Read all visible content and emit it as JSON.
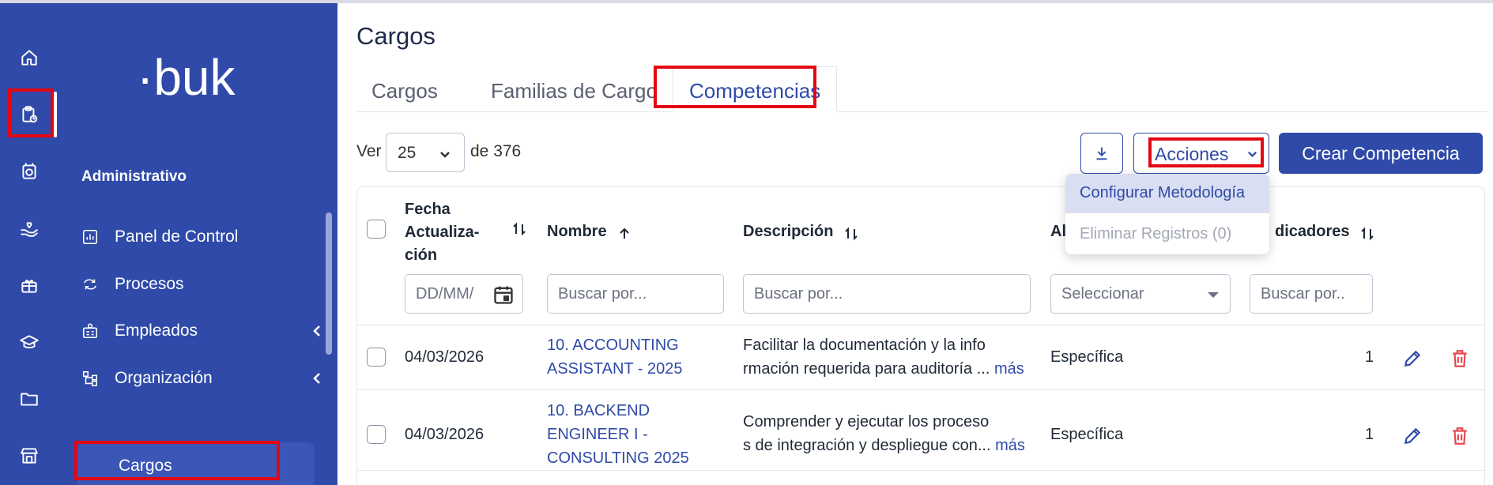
{
  "sidebar": {
    "logo_text": "·buk·",
    "section_title": "Administrativo",
    "nav_items": [
      {
        "label": "Panel de Control",
        "icon": "chart-icon"
      },
      {
        "label": "Procesos",
        "icon": "refresh-icon"
      },
      {
        "label": "Empleados",
        "icon": "employees-icon"
      },
      {
        "label": "Organización",
        "icon": "org-chart-icon"
      }
    ],
    "active_subitem": "Cargos"
  },
  "rail_icons": [
    "home-icon",
    "clipboard-clock-icon",
    "safe-icon",
    "hand-heart-icon",
    "gift-icon",
    "graduation-cap-icon",
    "folder-icon",
    "store-icon"
  ],
  "page": {
    "title": "Cargos",
    "tabs": [
      {
        "label": "Cargos",
        "active": false
      },
      {
        "label": "Familias de Cargo",
        "active": false
      },
      {
        "label": "Competencias",
        "active": true
      }
    ]
  },
  "toolbar": {
    "ver_label": "Ver",
    "page_size": "25",
    "total_label": "de 376",
    "actions_label": "Acciones",
    "create_label": "Crear Competencia"
  },
  "actions_menu": {
    "items": [
      {
        "label": "Configurar Metodología",
        "enabled": true
      },
      {
        "label": "Eliminar Registros (0)",
        "enabled": false
      }
    ]
  },
  "table": {
    "headers": {
      "fecha_line1": "Fecha",
      "fecha_line2": "Actualiza-",
      "fecha_line3": "ción",
      "nombre": "Nombre",
      "descripcion": "Descripción",
      "alcance": "Al",
      "indicadores": "dicadores"
    },
    "filters": {
      "fecha_placeholder": "DD/MM/",
      "nombre_placeholder": "Buscar por...",
      "descripcion_placeholder": "Buscar por...",
      "alcance_placeholder": "Seleccionar",
      "indicadores_placeholder": "Buscar por.."
    },
    "rows": [
      {
        "fecha": "04/03/2026",
        "nombre_line1": "10. ACCOUNTING",
        "nombre_line2": "ASSISTANT - 2025",
        "descripcion_line1": "Facilitar la documentación y la info",
        "descripcion_line2": "rmación requerida para auditoría ...",
        "more": "más",
        "alcance": "Específica",
        "indicadores": "1"
      },
      {
        "fecha": "04/03/2026",
        "nombre_line1": "10. BACKEND",
        "nombre_line2": "ENGINEER I -",
        "nombre_line3": "CONSULTING 2025",
        "descripcion_line1": "Comprender y ejecutar los proceso",
        "descripcion_line2": "s de integración y despliegue con...",
        "more": "más",
        "alcance": "Específica",
        "indicadores": "1"
      }
    ]
  },
  "colors": {
    "brand": "#2f4aa8",
    "highlight": "#e30613",
    "delete": "#e5484d"
  }
}
